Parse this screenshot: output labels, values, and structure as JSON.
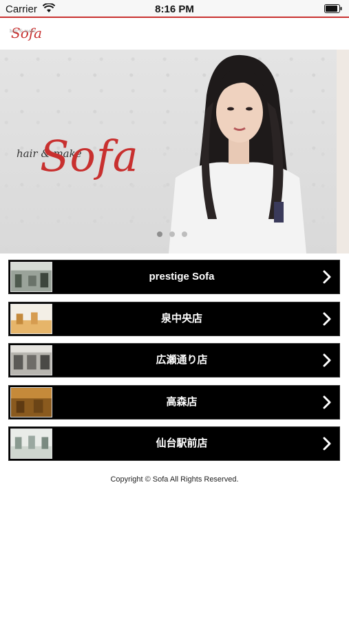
{
  "status_bar": {
    "carrier": "Carrier",
    "time": "8:16 PM"
  },
  "header": {
    "logo": "Sofa",
    "logo_small": "hair & make"
  },
  "banner": {
    "logo_small": "hair & make",
    "logo": "Sofa",
    "page_count": 3,
    "active_page": 1
  },
  "stores": [
    {
      "label": "prestige Sofa"
    },
    {
      "label": "泉中央店"
    },
    {
      "label": "広瀬通り店"
    },
    {
      "label": "高森店"
    },
    {
      "label": "仙台駅前店"
    }
  ],
  "footer": {
    "copyright": "Copyright © Sofa All Rights Reserved."
  },
  "colors": {
    "brand": "#c8302f",
    "row_bg": "#000000"
  }
}
